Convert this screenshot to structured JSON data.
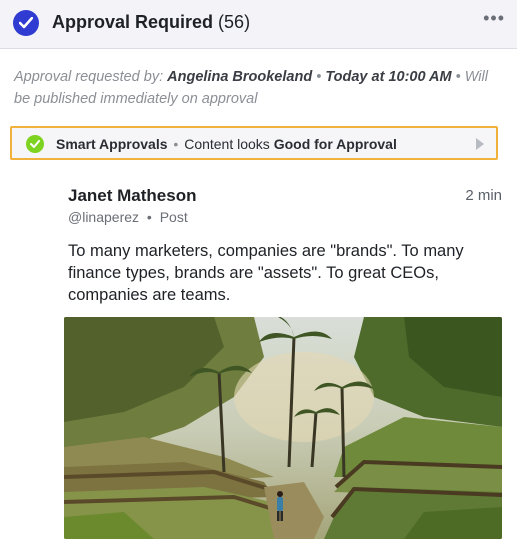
{
  "header": {
    "title": "Approval Required",
    "count": "(56)",
    "more": "•••"
  },
  "meta": {
    "requested_prefix": "Approval requested by:",
    "requester": "Angelina Brookeland",
    "sep1": " • ",
    "time": "Today at 10:00 AM",
    "sep2": " • ",
    "publish_note": "Will be published immediately on approval"
  },
  "smart_approvals": {
    "label": "Smart Approvals",
    "sep": "•",
    "prefix": "Content looks",
    "verdict": "Good for Approval"
  },
  "post": {
    "author": "Janet Matheson",
    "time": "2 min",
    "handle": "@linaperez",
    "sep": "•",
    "type": "Post",
    "text": "To many marketers, companies are \"brands\". To many finance types, brands are \"assets\". To great CEOs, companies are teams."
  },
  "colors": {
    "accent": "#2f3bd1",
    "smart_border": "#f1b23b",
    "ok_green": "#7ed321"
  }
}
